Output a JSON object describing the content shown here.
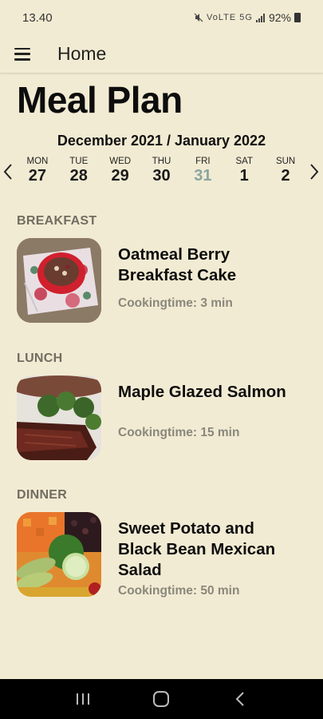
{
  "status_bar": {
    "time": "13.40",
    "network": "VoLTE 5G",
    "battery": "92%"
  },
  "app_bar": {
    "title": "Home",
    "menu_icon": "hamburger-menu-icon"
  },
  "page": {
    "title": "Meal Plan",
    "month_range": "December 2021 / January 2022"
  },
  "week": {
    "days": [
      {
        "name": "MON",
        "num": "27"
      },
      {
        "name": "TUE",
        "num": "28"
      },
      {
        "name": "WED",
        "num": "29"
      },
      {
        "name": "THU",
        "num": "30"
      },
      {
        "name": "FRI",
        "num": "31"
      },
      {
        "name": "SAT",
        "num": "1"
      },
      {
        "name": "SUN",
        "num": "2"
      }
    ],
    "selected_index": 4,
    "selected_color": "#8aa6a0"
  },
  "meals": {
    "breakfast": {
      "label": "BREAKFAST",
      "name": "Oatmeal Berry Breakfast Cake",
      "time": "Cookingtime: 3 min"
    },
    "lunch": {
      "label": "LUNCH",
      "name": "Maple Glazed Salmon",
      "time": "Cookingtime: 15 min"
    },
    "dinner": {
      "label": "DINNER",
      "name": "Sweet Potato and Black Bean Mexican Salad",
      "time": "Cookingtime: 50 min"
    }
  },
  "colors": {
    "background": "#f2ebd3",
    "section_label": "#706d62",
    "cooking_time": "#8a877c"
  }
}
